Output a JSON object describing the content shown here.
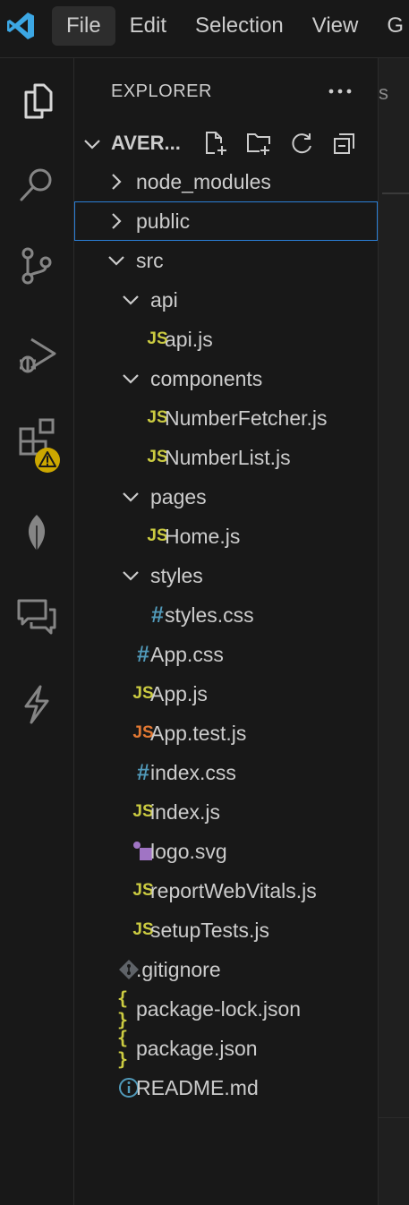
{
  "menu": {
    "items": [
      "File",
      "Edit",
      "Selection",
      "View",
      "G"
    ]
  },
  "activity_bar": {
    "icons": [
      "explorer-icon",
      "search-icon",
      "source-control-icon",
      "run-debug-icon",
      "extensions-icon",
      "mongodb-leaf-icon",
      "remote-chat-icon",
      "thunder-client-icon"
    ],
    "warning_badge": "!"
  },
  "explorer": {
    "title": "EXPLORER",
    "more": "···",
    "project_name": "AVER...",
    "items": [
      {
        "label": "node_modules",
        "type": "folder",
        "open": false,
        "depth": 1
      },
      {
        "label": "public",
        "type": "folder",
        "open": false,
        "depth": 1
      },
      {
        "label": "src",
        "type": "folder",
        "open": true,
        "depth": 1
      },
      {
        "label": "api",
        "type": "folder",
        "open": true,
        "depth": 2
      },
      {
        "label": "api.js",
        "type": "js",
        "depth": 3
      },
      {
        "label": "components",
        "type": "folder",
        "open": true,
        "depth": 2
      },
      {
        "label": "NumberFetcher.js",
        "type": "js",
        "depth": 3
      },
      {
        "label": "NumberList.js",
        "type": "js",
        "depth": 3
      },
      {
        "label": "pages",
        "type": "folder",
        "open": true,
        "depth": 2
      },
      {
        "label": "Home.js",
        "type": "js",
        "depth": 3
      },
      {
        "label": "styles",
        "type": "folder",
        "open": true,
        "depth": 2
      },
      {
        "label": "styles.css",
        "type": "css",
        "depth": 3
      },
      {
        "label": "App.css",
        "type": "css",
        "depth": 2
      },
      {
        "label": "App.js",
        "type": "js",
        "depth": 2
      },
      {
        "label": "App.test.js",
        "type": "jstest",
        "depth": 2
      },
      {
        "label": "index.css",
        "type": "css",
        "depth": 2
      },
      {
        "label": "index.js",
        "type": "js",
        "depth": 2
      },
      {
        "label": "logo.svg",
        "type": "svg",
        "depth": 2
      },
      {
        "label": "reportWebVitals.js",
        "type": "js",
        "depth": 2
      },
      {
        "label": "setupTests.js",
        "type": "js",
        "depth": 2
      },
      {
        "label": ".gitignore",
        "type": "git",
        "depth": 1
      },
      {
        "label": "package-lock.json",
        "type": "json",
        "depth": 1
      },
      {
        "label": "package.json",
        "type": "json",
        "depth": 1
      },
      {
        "label": "README.md",
        "type": "info",
        "depth": 1
      }
    ],
    "focused_item": "public"
  },
  "file_icon_glyphs": {
    "js": "JS",
    "jstest": "JS",
    "css": "#",
    "json": "{ }"
  },
  "editor": {
    "tab_fragment": "s"
  },
  "colors": {
    "accent": "#2b7fd6",
    "js": "#cbcb41",
    "js_test": "#e37933",
    "css": "#519aba",
    "svg": "#a074c4",
    "vscode_logo": "#3ca7e4"
  }
}
